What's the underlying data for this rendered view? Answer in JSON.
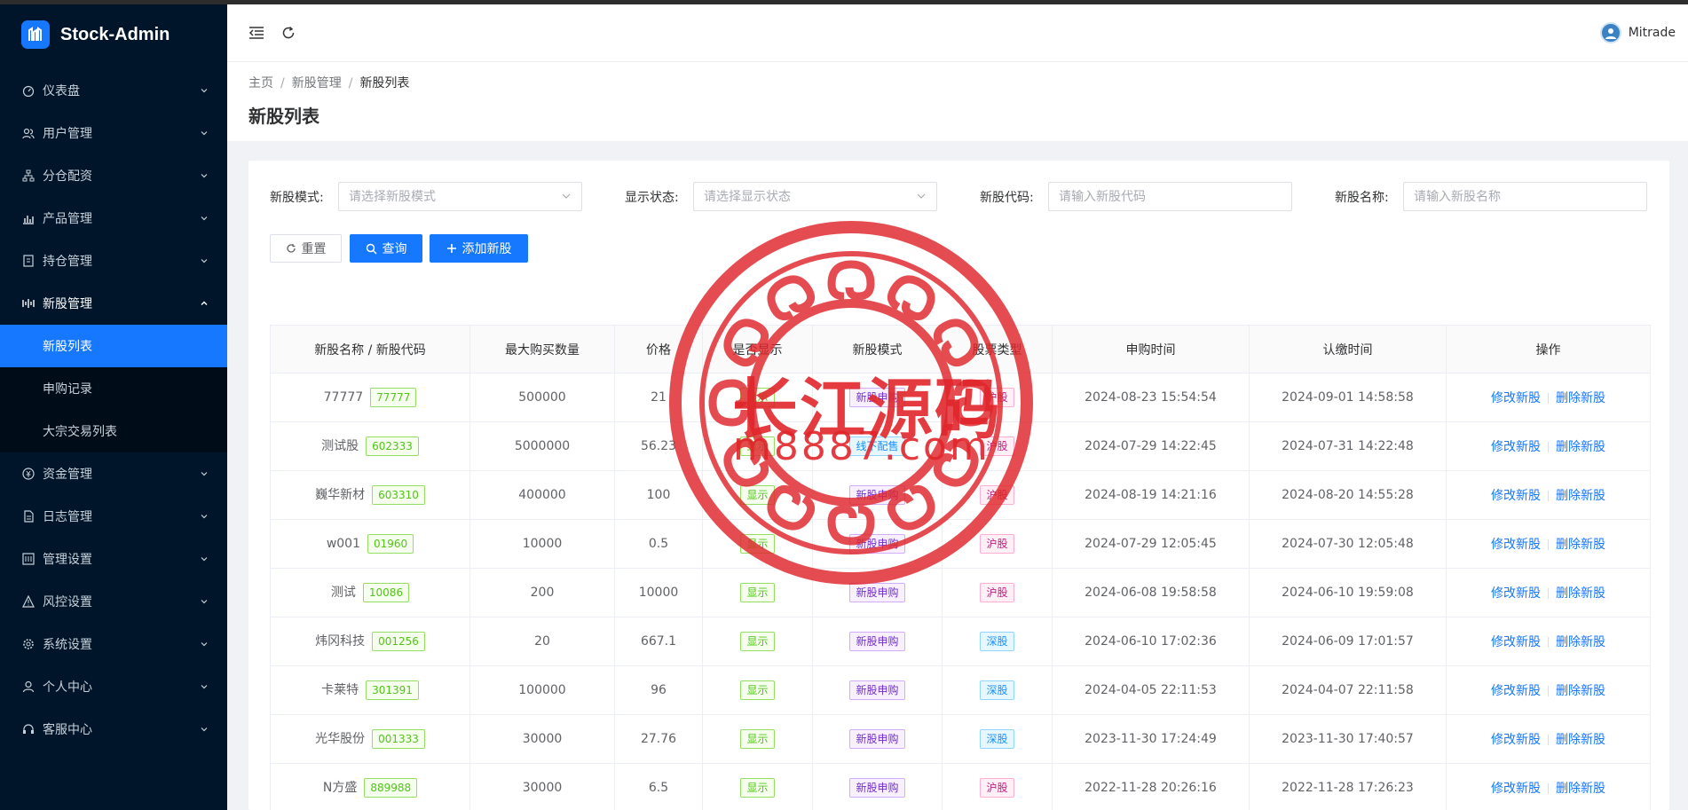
{
  "app": {
    "name": "Stock-Admin"
  },
  "sidebar": {
    "items": [
      {
        "label": "仪表盘",
        "icon": "dashboard-icon"
      },
      {
        "label": "用户管理",
        "icon": "users-icon"
      },
      {
        "label": "分仓配资",
        "icon": "sitemap-icon"
      },
      {
        "label": "产品管理",
        "icon": "bar-chart-icon"
      },
      {
        "label": "持仓管理",
        "icon": "position-icon"
      },
      {
        "label": "新股管理",
        "icon": "ipo-icon",
        "open": true,
        "children": [
          {
            "label": "新股列表",
            "active": true
          },
          {
            "label": "申购记录"
          },
          {
            "label": "大宗交易列表"
          }
        ]
      },
      {
        "label": "资金管理",
        "icon": "money-icon"
      },
      {
        "label": "日志管理",
        "icon": "log-icon"
      },
      {
        "label": "管理设置",
        "icon": "admin-settings-icon"
      },
      {
        "label": "风控设置",
        "icon": "warning-icon"
      },
      {
        "label": "系统设置",
        "icon": "gear-icon"
      },
      {
        "label": "个人中心",
        "icon": "user-icon"
      },
      {
        "label": "客服中心",
        "icon": "headset-icon"
      }
    ]
  },
  "header": {
    "username": "Mitrade"
  },
  "breadcrumb": [
    "主页",
    "新股管理",
    "新股列表"
  ],
  "page": {
    "title": "新股列表"
  },
  "filters": {
    "mode_label": "新股模式:",
    "mode_placeholder": "请选择新股模式",
    "status_label": "显示状态:",
    "status_placeholder": "请选择显示状态",
    "code_label": "新股代码:",
    "code_placeholder": "请输入新股代码",
    "name_label": "新股名称:",
    "name_placeholder": "请输入新股名称"
  },
  "buttons": {
    "reset": "重置",
    "search": "查询",
    "add": "添加新股"
  },
  "table": {
    "columns": [
      "新股名称 / 新股代码",
      "最大购买数量",
      "价格",
      "是否显示",
      "新股模式",
      "股票类型",
      "申购时间",
      "认缴时间",
      "操作"
    ],
    "op_edit": "修改新股",
    "op_delete": "删除新股",
    "rows": [
      {
        "name": "77777",
        "code": "77777",
        "max": "500000",
        "price": "21",
        "show": "显示",
        "mode": "新股申购",
        "type": "沪股",
        "apply": "2024-08-23 15:54:54",
        "pay": "2024-09-01 14:58:58"
      },
      {
        "name": "测试股",
        "code": "602333",
        "max": "5000000",
        "price": "56.23",
        "show": "显示",
        "mode": "线下配售",
        "type": "沪股",
        "apply": "2024-07-29 14:22:45",
        "pay": "2024-07-31 14:22:48"
      },
      {
        "name": "巍华新材",
        "code": "603310",
        "max": "400000",
        "price": "100",
        "show": "显示",
        "mode": "新股申购",
        "type": "沪股",
        "apply": "2024-08-19 14:21:16",
        "pay": "2024-08-20 14:55:28"
      },
      {
        "name": "w001",
        "code": "01960",
        "max": "10000",
        "price": "0.5",
        "show": "显示",
        "mode": "新股申购",
        "type": "沪股",
        "apply": "2024-07-29 12:05:45",
        "pay": "2024-07-30 12:05:48"
      },
      {
        "name": "测试",
        "code": "10086",
        "max": "200",
        "price": "10000",
        "show": "显示",
        "mode": "新股申购",
        "type": "沪股",
        "apply": "2024-06-08 19:58:58",
        "pay": "2024-06-10 19:59:08"
      },
      {
        "name": "炜冈科技",
        "code": "001256",
        "max": "20",
        "price": "667.1",
        "show": "显示",
        "mode": "新股申购",
        "type": "深股",
        "apply": "2024-06-10 17:02:36",
        "pay": "2024-06-09 17:01:57"
      },
      {
        "name": "卡莱特",
        "code": "301391",
        "max": "100000",
        "price": "96",
        "show": "显示",
        "mode": "新股申购",
        "type": "深股",
        "apply": "2024-04-05 22:11:53",
        "pay": "2024-04-07 22:11:58"
      },
      {
        "name": "光华股份",
        "code": "001333",
        "max": "30000",
        "price": "27.76",
        "show": "显示",
        "mode": "新股申购",
        "type": "深股",
        "apply": "2023-11-30 17:24:49",
        "pay": "2023-11-30 17:40:57"
      },
      {
        "name": "N方盛",
        "code": "889988",
        "max": "30000",
        "price": "6.5",
        "show": "显示",
        "mode": "新股申购",
        "type": "沪股",
        "apply": "2022-11-28 20:26:16",
        "pay": "2022-11-28 17:26:23"
      }
    ]
  },
  "watermark": {
    "cn": "长江源码",
    "en": "m8887.com"
  },
  "colors": {
    "sidebar": "#001529",
    "accent": "#1677ff",
    "stamp": "#e0262b"
  }
}
